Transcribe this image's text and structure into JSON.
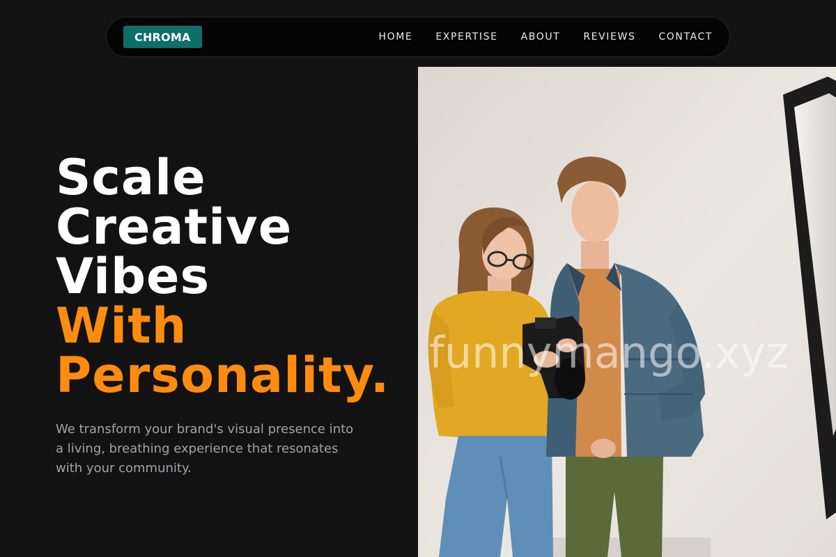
{
  "brand": {
    "logo_text": "CHROMA"
  },
  "nav": {
    "items": [
      "HOME",
      "EXPERTISE",
      "ABOUT",
      "REVIEWS",
      "CONTACT"
    ]
  },
  "hero": {
    "headline_white": [
      "Scale",
      "Creative",
      "Vibes"
    ],
    "headline_accent": [
      "With",
      "Personality."
    ],
    "subtext": "We transform your brand's visual presence into a living, breathing experience that resonates with your community."
  },
  "photo": {
    "watermark": "funnymango.xyz"
  },
  "colors": {
    "background": "#121212",
    "accent": "#ff8c0e",
    "logo_bg": "#0d6e6a",
    "nav_bg": "#050505",
    "subtext": "#a3a3a8"
  }
}
